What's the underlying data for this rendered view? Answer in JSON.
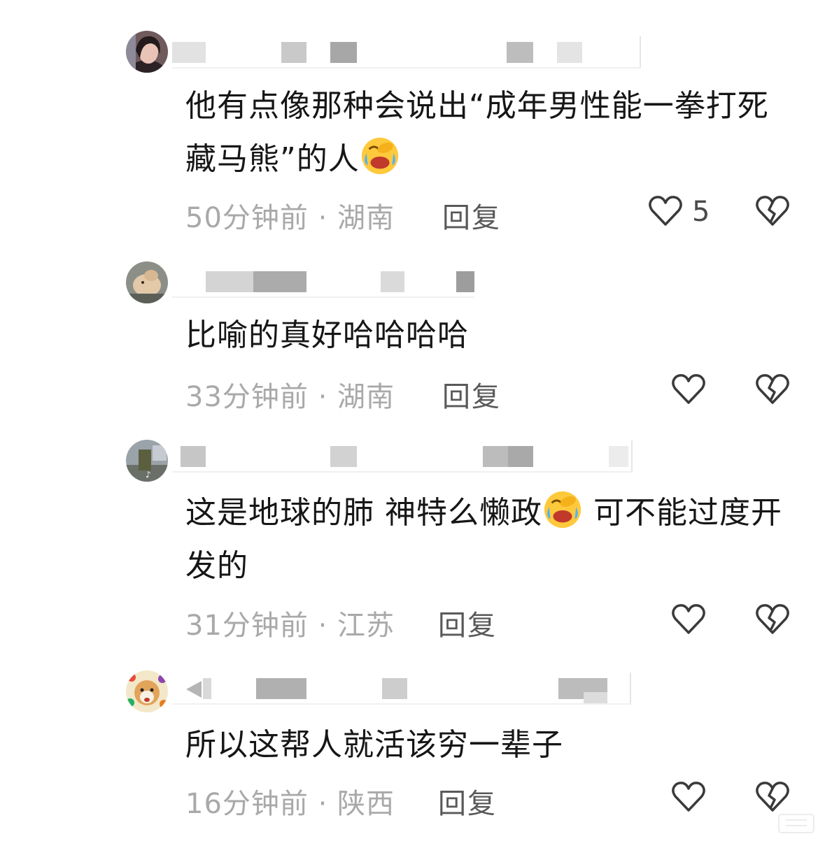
{
  "comments": [
    {
      "text": "他有点像那种会说出“成年男性能一拳打死藏马熊”的人",
      "time_location": "50分钟前 · 湖南",
      "reply_label": "回复",
      "like_count": "5"
    },
    {
      "text": "比喻的真好哈哈哈哈",
      "time_location": "33分钟前 · 湖南",
      "reply_label": "回复",
      "like_count": ""
    },
    {
      "text_part1": "这是地球的肺 神特么懒政",
      "text_part2": " 可不能过度开发的",
      "time_location": "31分钟前 · 江苏",
      "reply_label": "回复",
      "like_count": ""
    },
    {
      "text": "所以这帮人就活该穷一辈子",
      "time_location": "16分钟前 · 陕西",
      "reply_label": "回复",
      "like_count": ""
    }
  ],
  "icons": {
    "like": "heart-outline-icon",
    "dislike": "broken-heart-icon",
    "emoji": "laughing-crying-emoji"
  },
  "colors": {
    "text": "#161616",
    "meta": "#a9a9a9",
    "icon": "#3a3a3a"
  }
}
